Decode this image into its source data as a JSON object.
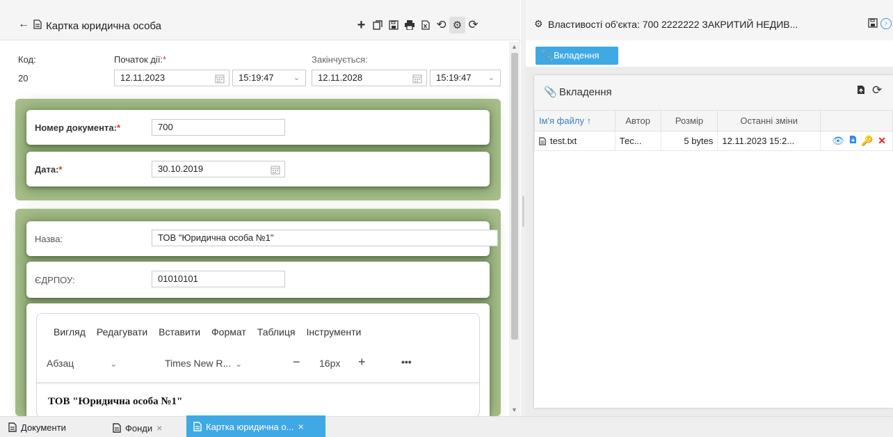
{
  "left": {
    "title": "Картка юридична особа",
    "toolbar": [
      "+",
      "❐",
      "⎙",
      "⎙",
      "⎘",
      "↺",
      "⚙",
      "⟳"
    ],
    "code": {
      "label": "Код:",
      "value": "20"
    },
    "start": {
      "label": "Початок дії:",
      "required": "*",
      "date": "12.11.2023",
      "time": "15:19:47"
    },
    "end": {
      "label": "Закінчується:",
      "date": "12.11.2028",
      "time": "15:19:47"
    },
    "doc_number": {
      "label": "Номер документа:",
      "required": "*",
      "value": "700"
    },
    "doc_date": {
      "label": "Дата:",
      "required": "*",
      "value": "30.10.2019"
    },
    "name": {
      "label": "Назва:",
      "value": "ТОВ \"Юридична особа №1\""
    },
    "edrpou": {
      "label": "ЄДРПОУ:",
      "value": "01010101"
    },
    "editor": {
      "menu": [
        "Вигляд",
        "Редагувати",
        "Вставити",
        "Формат",
        "Таблиця",
        "Інструменти"
      ],
      "block": "Абзац",
      "font": "Times New R...",
      "minus": "−",
      "size": "16px",
      "plus": "+",
      "more": "•••",
      "content": "ТОВ \"Юридична особа №1\""
    }
  },
  "right": {
    "title": "Властивості об'єкта: 700 2222222 ЗАКРИТИЙ НЕДИВ...",
    "button": "Вкладення",
    "panel_title": "Вкладення",
    "columns": [
      "Ім'я файлу ↑",
      "Автор",
      "Розмір",
      "Останні зміни",
      ""
    ],
    "rows": [
      {
        "file": "test.txt",
        "author": "Тес...",
        "size": "5 bytes",
        "modified": "12.11.2023 15:2..."
      }
    ]
  },
  "tabs": [
    {
      "label": "Документи",
      "closable": false
    },
    {
      "label": "Фонди",
      "closable": true
    },
    {
      "label": "Картка юридична о...",
      "closable": true,
      "active": true
    }
  ],
  "colors": {
    "accent": "#3fa9e6",
    "group_bg": "#a8c08c",
    "required": "#d9363e",
    "delete": "#e02424"
  },
  "icons": [
    "back-arrow-icon",
    "document-icon",
    "add-icon",
    "copy-icon",
    "save-icon",
    "print-icon",
    "excel-icon",
    "history-icon",
    "settings-icon",
    "refresh-icon",
    "calendar-icon",
    "chevron-down-icon",
    "paperclip-icon",
    "download-icon",
    "eye-icon",
    "key-icon",
    "close-icon"
  ]
}
